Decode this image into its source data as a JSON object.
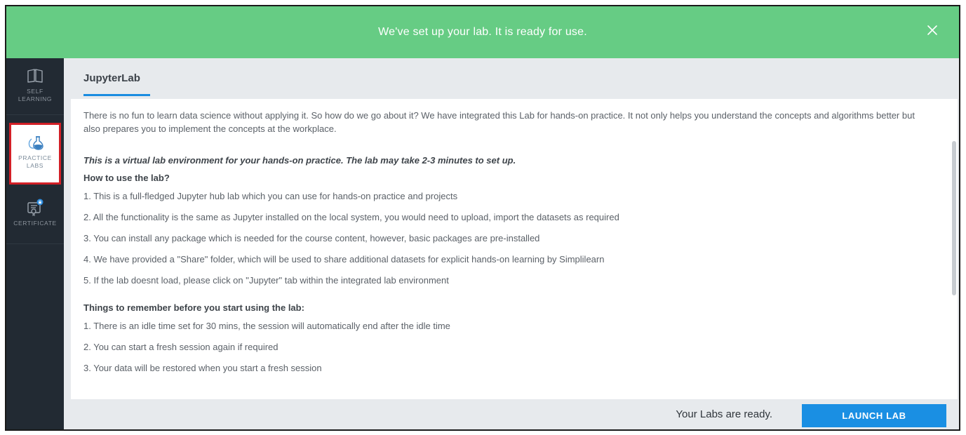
{
  "banner": {
    "message": "We've set up your lab. It is ready for use.",
    "close_icon": "close-icon",
    "color": "#66cc84"
  },
  "sidebar": {
    "items": [
      {
        "icon": "book-icon",
        "label": "SELF LEARNING"
      },
      {
        "icon": "flask-icon",
        "label": "PRACTICE LABS",
        "active": true
      },
      {
        "icon": "certificate-icon",
        "label": "CERTIFICATE"
      }
    ]
  },
  "main": {
    "tab": "JupyterLab",
    "intro": "There is no fun to learn data science without applying it. So how do we go about it? We have integrated this Lab for hands-on practice. It not only helps you understand the concepts and algorithms better but also prepares you to implement the concepts at the workplace.",
    "notice": "This is a virtual lab environment for your hands-on practice. The lab may take 2-3 minutes to set up.",
    "how_heading": "How to use the lab?",
    "how_items": [
      "1. This is a full-fledged Jupyter hub lab which you can use for hands-on practice and projects",
      "2. All the functionality is the same as Jupyter installed on the local system, you would need to upload, import the datasets as required",
      "3. You can install any package which is needed for the course content, however, basic packages are pre-installed",
      "4. We have provided a \"Share\" folder, which will be used to share additional datasets for explicit hands-on learning by Simplilearn",
      "5. If the lab doesnt load, please click on \"Jupyter\" tab within the integrated lab environment"
    ],
    "remember_heading": "Things to remember before you start using the lab:",
    "remember_items": [
      "1. There is an idle time set for 30 mins, the session will automatically end after the idle time",
      "2. You can start a fresh session again if required",
      "3. Your data will be restored when you start a fresh session"
    ]
  },
  "footer": {
    "status": "Your Labs are ready.",
    "launch_label": "LAUNCH LAB",
    "accent": "#1a8fe3"
  }
}
